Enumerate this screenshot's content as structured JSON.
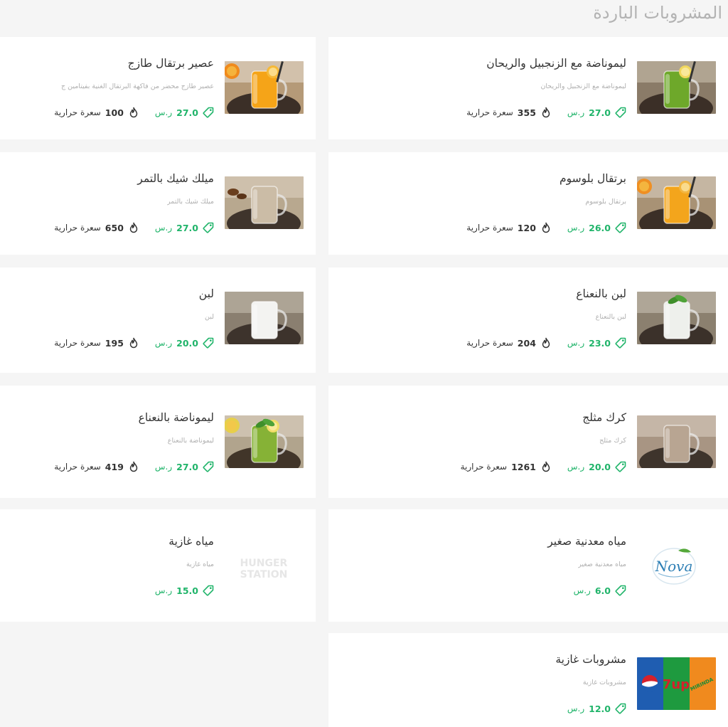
{
  "section": {
    "title": "المشروبات الباردة"
  },
  "labels": {
    "calories": "سعرة حرارية"
  },
  "colors": {
    "price": "#20b46a",
    "background": "#f5f5f5",
    "card": "#ffffff"
  },
  "items": [
    {
      "name": "ليموناضة مع الزنجبيل والريحان",
      "description": "ليموناضة مع الزنجبيل والريحان",
      "price": "27.0",
      "currency": "ر.س",
      "calories": "355",
      "image": "green-lemonade-image"
    },
    {
      "name": "عصير برتقال طازج",
      "description": "عصير طازج محضر من فاكهة البرتقال الغنية بفيتامين ج",
      "price": "27.0",
      "currency": "ر.س",
      "calories": "100",
      "image": "orange-juice-image"
    },
    {
      "name": "برتقال بلوسوم",
      "description": "برتقال بلوسوم",
      "price": "26.0",
      "currency": "ر.س",
      "calories": "120",
      "image": "orange-blossom-image"
    },
    {
      "name": "ميلك شيك بالتمر",
      "description": "ميلك شيك بالتمر",
      "price": "27.0",
      "currency": "ر.س",
      "calories": "650",
      "image": "date-milkshake-image"
    },
    {
      "name": "لبن بالنعناع",
      "description": "لبن بالنعناع",
      "price": "23.0",
      "currency": "ر.س",
      "calories": "204",
      "image": "mint-laban-image"
    },
    {
      "name": "لبن",
      "description": "لبن",
      "price": "20.0",
      "currency": "ر.س",
      "calories": "195",
      "image": "laban-image"
    },
    {
      "name": "كرك مثلج",
      "description": "كرك مثلج",
      "price": "20.0",
      "currency": "ر.س",
      "calories": "1261",
      "image": "iced-karak-image"
    },
    {
      "name": "ليموناضة بالنعناع",
      "description": "ليموناضة بالنعناع",
      "price": "27.0",
      "currency": "ر.س",
      "calories": "419",
      "image": "mint-lemonade-image"
    },
    {
      "name": "مياه معدنية صغير",
      "description": "مياه معدنية صغير",
      "price": "6.0",
      "currency": "ر.س",
      "calories": "",
      "image": "nova-logo"
    },
    {
      "name": "مياه غازية",
      "description": "مياه غازية",
      "price": "15.0",
      "currency": "ر.س",
      "calories": "",
      "image": "placeholder-logo",
      "placeholder_text": [
        "HUNGER",
        "STATION"
      ]
    },
    {
      "name": "مشروبات غازية",
      "description": "مشروبات غازية",
      "price": "12.0",
      "currency": "ر.س",
      "calories": "",
      "image": "soft-drinks-image",
      "logo_texts": [
        "7up",
        "MIRINDA"
      ]
    }
  ]
}
